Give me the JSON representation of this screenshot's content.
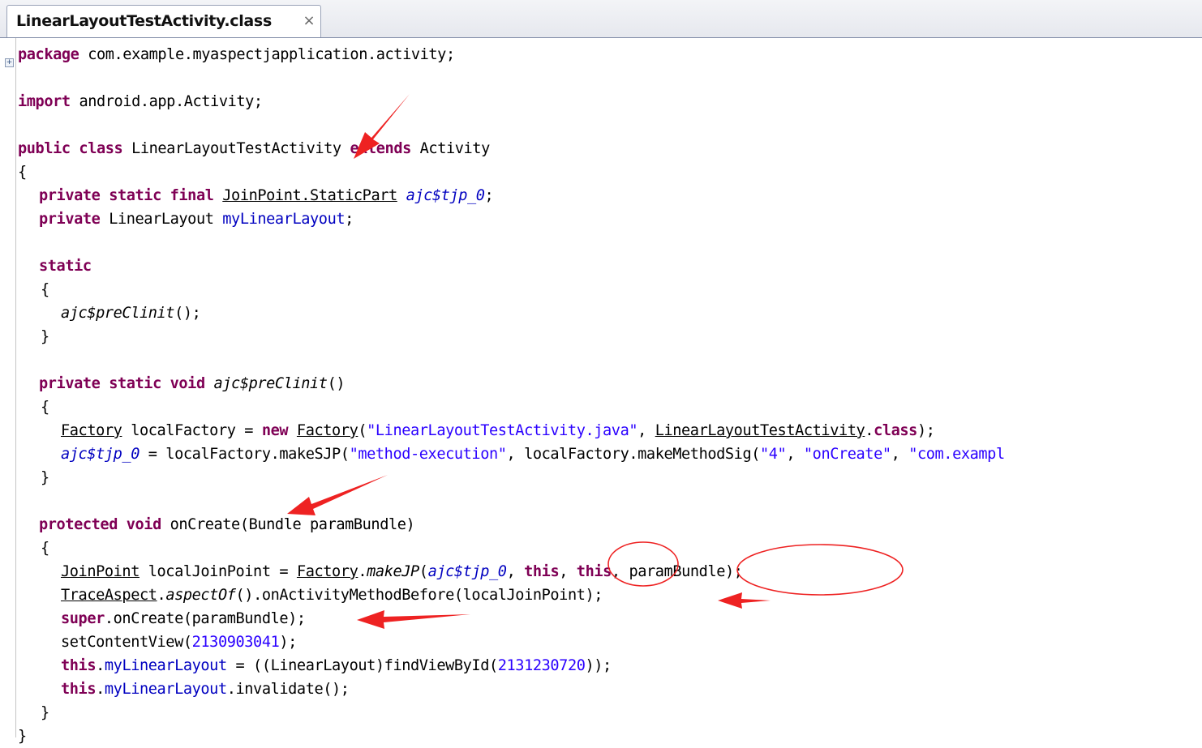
{
  "tab": {
    "title": "LinearLayoutTestActivity.class",
    "close_glyph": "×"
  },
  "code": {
    "package_kw": "package",
    "package_name": "com.example.myaspectjapplication.activity;",
    "import_kw": "import",
    "import_name": "android.app.Activity;",
    "class_kw": "public class",
    "class_name": "LinearLayoutTestActivity",
    "extends_kw": "extends",
    "parent_class": "Activity",
    "open_brace": "{",
    "close_brace": "}",
    "field1_kw": "private static final",
    "field1_type": "JoinPoint.StaticPart",
    "field1_name": "ajc$tjp_0",
    "semicolon": ";",
    "field2_kw": "private",
    "field2_type": "LinearLayout",
    "field2_name": "myLinearLayout",
    "static_kw": "static",
    "preclinit_call": "ajc$preClinit",
    "call_parens": "();",
    "method1_kw": "private static void",
    "method1_name": "ajc$preClinit",
    "empty_parens": "()",
    "factory_type": "Factory",
    "local_factory_decl": " localFactory = ",
    "new_kw": "new",
    "paren_open": "(",
    "filename_str": "\"LinearLayoutTestActivity.java\"",
    "comma_space": ", ",
    "class_ref": "LinearLayoutTestActivity",
    "dot": ".",
    "class_kw2": "class",
    "paren_close_semi": ");",
    "tjp_field": "ajc$tjp_0",
    "make_sjp": " = localFactory.makeSJP(",
    "method_exec_str": "\"method-execution\"",
    "make_method_sig": ", localFactory.makeMethodSig(",
    "four_str": "\"4\"",
    "oncreate_str": "\"onCreate\"",
    "com_example_str": "\"com.exampl",
    "method2_kw": "protected void",
    "method2_sig": "onCreate(Bundle paramBundle)",
    "joinpoint_type": "JoinPoint",
    "local_jp_decl": " localJoinPoint = ",
    "make_jp": "makeJP",
    "this_kw": "this",
    "param_bundle_end": "paramBundle);",
    "trace_aspect": "TraceAspect",
    "aspect_of": "aspectOf",
    "before_call": "().onActivityMethodBefore(localJoinPoint);",
    "super_kw": "super",
    "super_call": ".onCreate(paramBundle);",
    "set_content_view": "setContentView(",
    "layout_id": "2130903041",
    "find_view_pre": " = ((LinearLayout)findViewById(",
    "view_id": "2131230720",
    "find_view_post": "));",
    "invalidate_call": ".invalidate();"
  },
  "annotation_color": "#ee2222"
}
